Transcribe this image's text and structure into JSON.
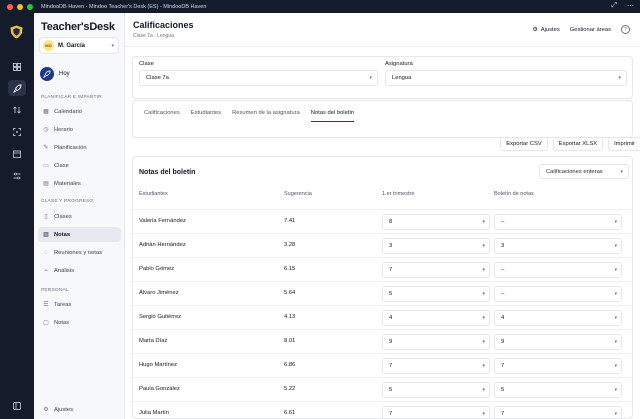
{
  "window": {
    "title": "MindooDB Haven - Mindoo Teacher's Desk (ES) - MindooDB Haven"
  },
  "sidebar": {
    "brand_a": "Teacher's",
    "brand_b": "Desk",
    "user": {
      "initials": "MG",
      "name": "M. García"
    },
    "today": "Hoy",
    "section_plan": "PLANIFICAR E IMPARTIR",
    "plan_items": [
      {
        "label": "Calendario",
        "icon": "calendar-icon"
      },
      {
        "label": "Horario",
        "icon": "clock-icon"
      },
      {
        "label": "Planificación",
        "icon": "edit-icon"
      },
      {
        "label": "Clase",
        "icon": "present-icon"
      },
      {
        "label": "Materiales",
        "icon": "folder-icon"
      }
    ],
    "section_class": "CLASE Y PROGRESO",
    "class_items": [
      {
        "label": "Clases",
        "icon": "book-icon"
      },
      {
        "label": "Notas",
        "icon": "grades-icon"
      },
      {
        "label": "Reuniones y notas",
        "icon": "chat-icon"
      },
      {
        "label": "Análisis",
        "icon": "chart-icon"
      }
    ],
    "section_personal": "PERSONAL",
    "personal_items": [
      {
        "label": "Tareas",
        "icon": "tasks-icon"
      },
      {
        "label": "Notas",
        "icon": "note-icon"
      }
    ],
    "settings": "Ajustes"
  },
  "header": {
    "title": "Calificaciones",
    "breadcrumb": "Clase 7a · Lengua",
    "settings_label": "Ajustes",
    "manage_label": "Gestionar áreas",
    "help": "?"
  },
  "filters": {
    "class_label": "Clase",
    "class_value": "Clase 7a",
    "subject_label": "Asignatura",
    "subject_value": "Lengua"
  },
  "tabs": [
    {
      "label": "Calificaciones"
    },
    {
      "label": "Estudiantes"
    },
    {
      "label": "Resumen de la asignatura"
    },
    {
      "label": "Notas del boletín"
    }
  ],
  "actions": {
    "csv": "Exportar CSV",
    "xlsx": "Exportar XLSX",
    "print": "Imprimir"
  },
  "report": {
    "title": "Notas del boletín",
    "filter_value": "Calificaciones enteras",
    "columns": [
      "Estudiantes",
      "Sugerencia",
      "1.er trimestre",
      "Boletín de notas"
    ],
    "rows": [
      {
        "name": "Valeria Fernández",
        "suggestion": "7.41",
        "term1": "8",
        "report": "–"
      },
      {
        "name": "Adrián Hernández",
        "suggestion": "3.28",
        "term1": "3",
        "report": "3"
      },
      {
        "name": "Pablo Gómez",
        "suggestion": "6.15",
        "term1": "7",
        "report": "–"
      },
      {
        "name": "Álvaro Jiménez",
        "suggestion": "5.64",
        "term1": "5",
        "report": "–"
      },
      {
        "name": "Sergio Gutiérrez",
        "suggestion": "4.13",
        "term1": "4",
        "report": "4"
      },
      {
        "name": "Marta Díaz",
        "suggestion": "8.01",
        "term1": "9",
        "report": "9"
      },
      {
        "name": "Hugo Martínez",
        "suggestion": "6.86",
        "term1": "7",
        "report": "7"
      },
      {
        "name": "Paula González",
        "suggestion": "5.22",
        "term1": "5",
        "report": "5"
      },
      {
        "name": "Julia Martín",
        "suggestion": "6.61",
        "term1": "7",
        "report": "7"
      }
    ]
  }
}
